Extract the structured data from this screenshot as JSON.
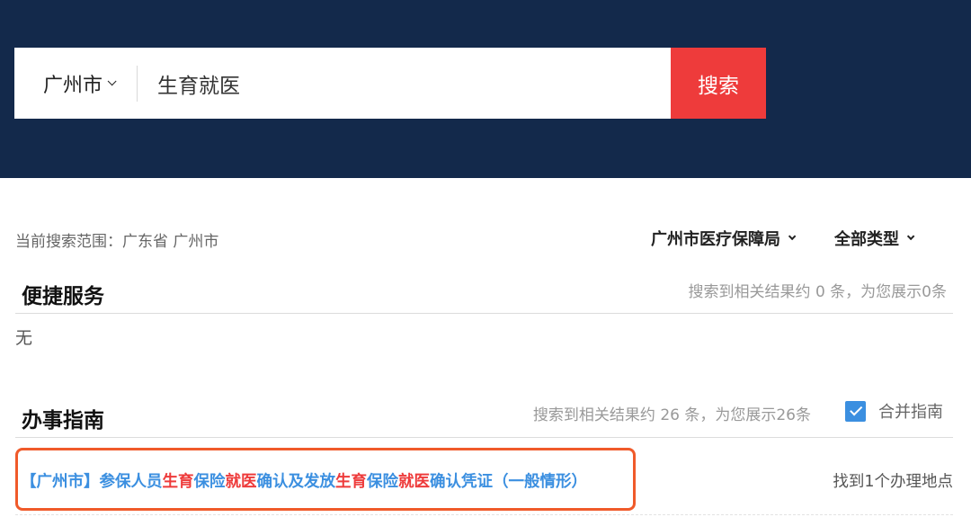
{
  "search": {
    "city": "广州市",
    "query": "生育就医",
    "button_label": "搜索"
  },
  "scope": {
    "text": "当前搜索范围：广东省 广州市"
  },
  "filters": {
    "bureau": "广州市医疗保障局",
    "type": "全部类型"
  },
  "quick_services": {
    "title": "便捷服务",
    "meta": "搜索到相关结果约 0 条，为您展示0条",
    "empty": "无"
  },
  "guides": {
    "title": "办事指南",
    "meta": "搜索到相关结果约 26 条，为您展示26条",
    "merge_label": "合并指南",
    "merge_checked": true,
    "results": [
      {
        "title_parts": [
          {
            "text": "【广州市】参保人员",
            "kw": false
          },
          {
            "text": "生育",
            "kw": true
          },
          {
            "text": "保险",
            "kw": false
          },
          {
            "text": "就医",
            "kw": true
          },
          {
            "text": "确认及发放",
            "kw": false
          },
          {
            "text": "生育",
            "kw": true
          },
          {
            "text": "保险",
            "kw": false
          },
          {
            "text": "就医",
            "kw": true
          },
          {
            "text": "确认凭证（一般情形）",
            "kw": false
          }
        ],
        "location": "找到1个办理地点"
      }
    ]
  },
  "colors": {
    "header_bg": "#13294b",
    "accent_red": "#ee3b3b",
    "link_blue": "#3b8fe0",
    "highlight_border": "#f05a2a"
  }
}
